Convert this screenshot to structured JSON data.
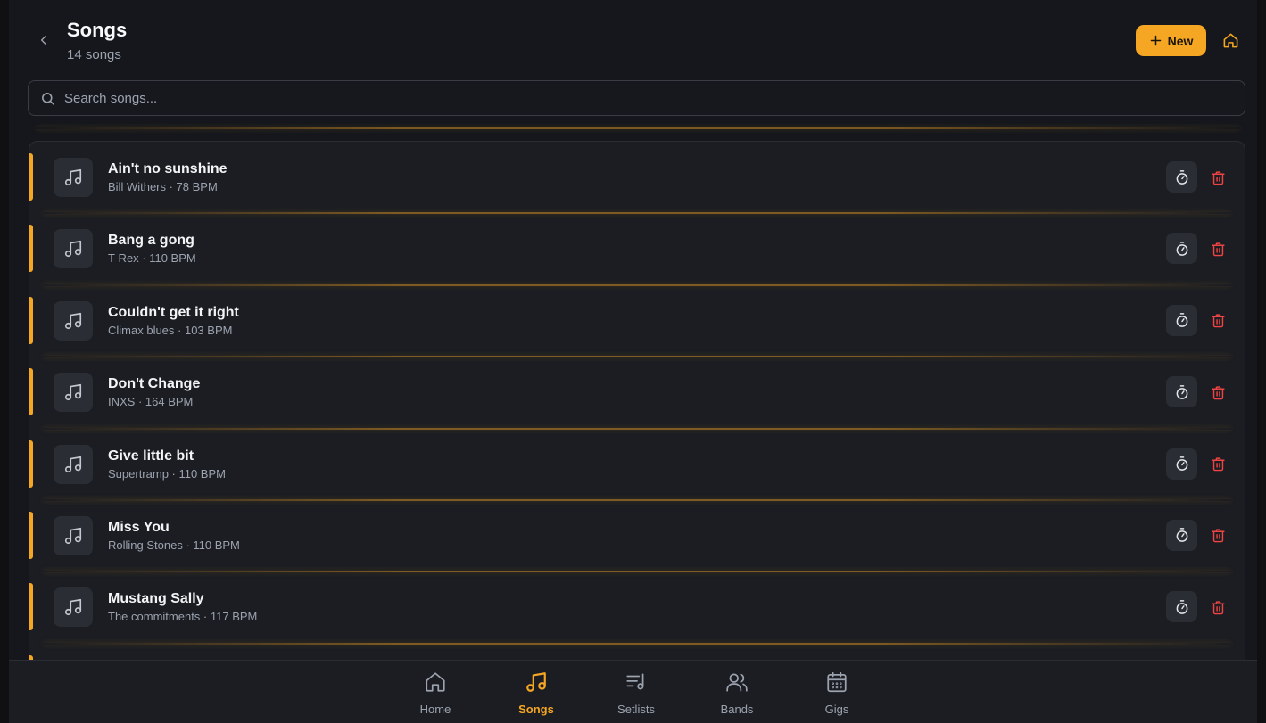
{
  "header": {
    "title": "Songs",
    "subtitle": "14 songs",
    "new_label": "New"
  },
  "search": {
    "placeholder": "Search songs..."
  },
  "songs": [
    {
      "title": "Ain't no sunshine",
      "meta": "Bill Withers · 78 BPM"
    },
    {
      "title": "Bang a gong",
      "meta": "T-Rex · 110 BPM"
    },
    {
      "title": "Couldn't get it right",
      "meta": "Climax blues · 103 BPM"
    },
    {
      "title": "Don't Change",
      "meta": "INXS · 164 BPM"
    },
    {
      "title": "Give little bit",
      "meta": "Supertramp · 110 BPM"
    },
    {
      "title": "Miss You",
      "meta": "Rolling Stones · 110 BPM"
    },
    {
      "title": "Mustang Sally",
      "meta": "The commitments · 117 BPM"
    }
  ],
  "nav": {
    "items": [
      {
        "label": "Home",
        "icon": "home-icon"
      },
      {
        "label": "Songs",
        "icon": "music-note-icon"
      },
      {
        "label": "Setlists",
        "icon": "setlist-icon"
      },
      {
        "label": "Bands",
        "icon": "users-icon"
      },
      {
        "label": "Gigs",
        "icon": "calendar-icon"
      }
    ],
    "active": "Songs"
  },
  "colors": {
    "accent": "#f5a623",
    "background": "#15171c",
    "card": "#1b1d22",
    "danger": "#ef4444",
    "muted_text": "#9ca3af"
  }
}
